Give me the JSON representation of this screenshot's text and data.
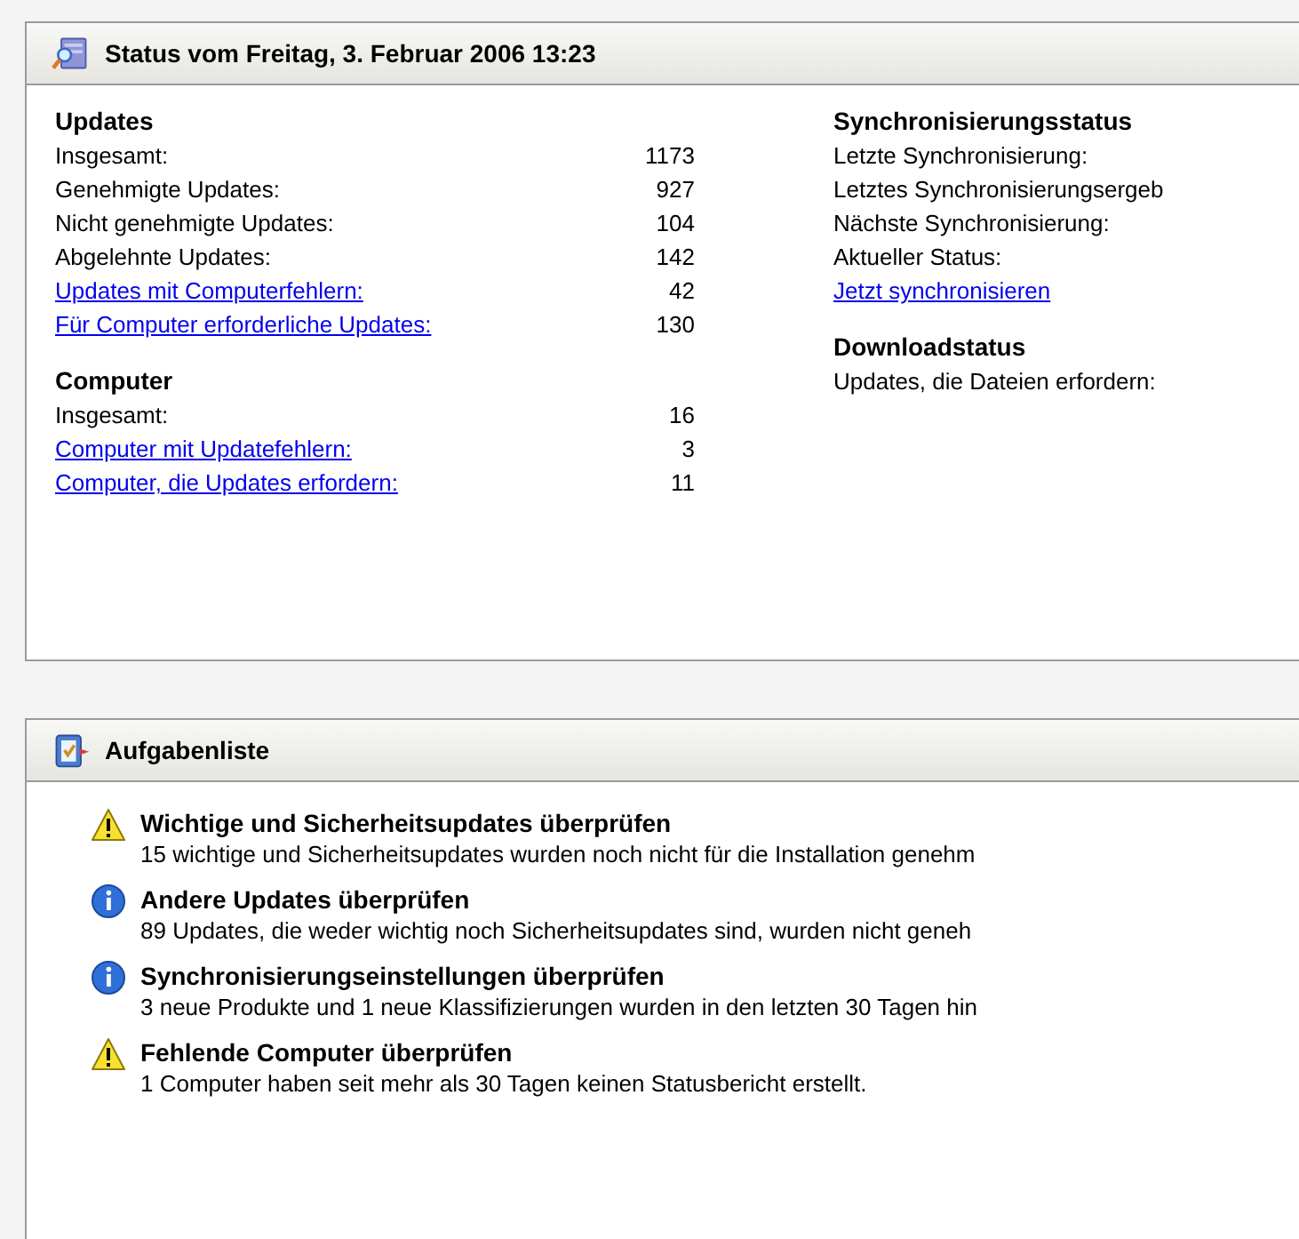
{
  "status_panel": {
    "title": "Status vom Freitag, 3. Februar 2006 13:23",
    "updates": {
      "heading": "Updates",
      "rows": [
        {
          "label": "Insgesamt:",
          "value": "1173",
          "kind": "text"
        },
        {
          "label": "Genehmigte Updates:",
          "value": "927",
          "kind": "text"
        },
        {
          "label": "Nicht genehmigte Updates:",
          "value": "104",
          "kind": "text"
        },
        {
          "label": "Abgelehnte Updates:",
          "value": "142",
          "kind": "text"
        },
        {
          "label": "Updates mit Computerfehlern:",
          "value": "42",
          "kind": "link"
        },
        {
          "label": "Für Computer erforderliche Updates:",
          "value": "130",
          "kind": "link"
        }
      ]
    },
    "computers": {
      "heading": "Computer",
      "rows": [
        {
          "label": "Insgesamt:",
          "value": "16",
          "kind": "text"
        },
        {
          "label": "Computer mit Updatefehlern:",
          "value": "3",
          "kind": "link"
        },
        {
          "label": "Computer, die Updates erfordern:",
          "value": "11",
          "kind": "link"
        }
      ]
    },
    "sync": {
      "heading": "Synchronisierungsstatus",
      "rows": [
        {
          "label": "Letzte Synchronisierung:",
          "kind": "text"
        },
        {
          "label": "Letztes Synchronisierungsergeb",
          "kind": "text"
        },
        {
          "label": "Nächste Synchronisierung:",
          "kind": "text"
        },
        {
          "label": "Aktueller Status:",
          "kind": "text"
        },
        {
          "label": "Jetzt synchronisieren",
          "kind": "link"
        }
      ]
    },
    "download": {
      "heading": "Downloadstatus",
      "rows": [
        {
          "label": "Updates, die Dateien erfordern:",
          "kind": "text"
        }
      ]
    }
  },
  "task_panel": {
    "title": "Aufgabenliste",
    "tasks": [
      {
        "kind": "warning",
        "title": "Wichtige und Sicherheitsupdates überprüfen",
        "description": "15 wichtige und Sicherheitsupdates wurden noch nicht für die Installation genehm"
      },
      {
        "kind": "info",
        "title": "Andere Updates überprüfen",
        "description": "89 Updates, die weder wichtig noch Sicherheitsupdates sind, wurden nicht geneh"
      },
      {
        "kind": "info",
        "title": "Synchronisierungseinstellungen überprüfen",
        "description": "3 neue Produkte und 1 neue Klassifizierungen wurden in den letzten 30 Tagen hin"
      },
      {
        "kind": "warning",
        "title": "Fehlende Computer überprüfen",
        "description": "1 Computer haben seit mehr als 30 Tagen keinen Statusbericht erstellt."
      }
    ]
  }
}
